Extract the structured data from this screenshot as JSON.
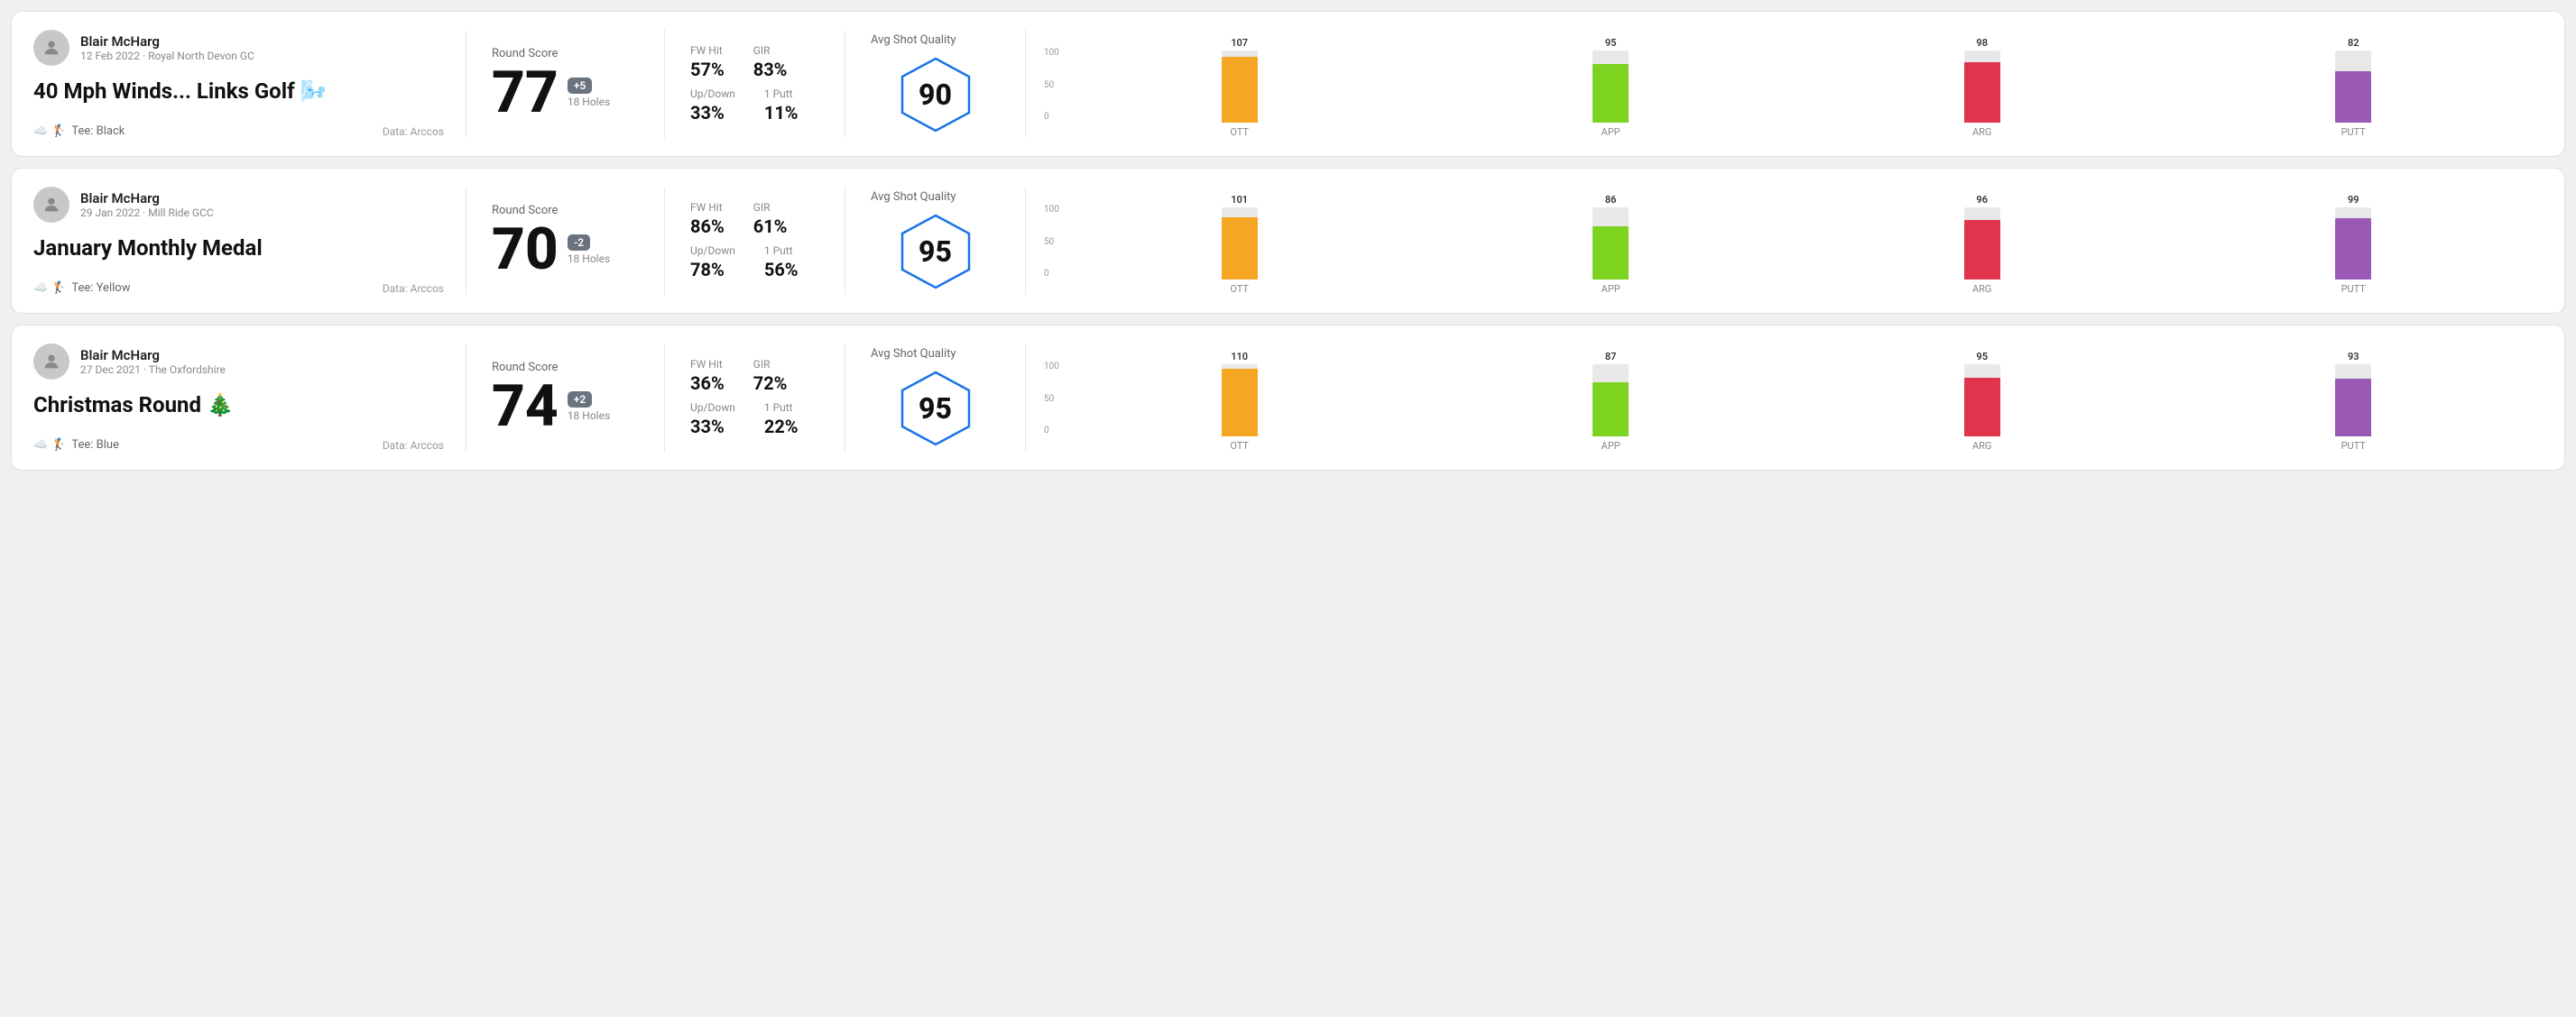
{
  "rounds": [
    {
      "id": "round1",
      "player_name": "Blair McHarg",
      "date": "12 Feb 2022 · Royal North Devon GC",
      "title": "40 Mph Winds... Links Golf 🌬️",
      "tee": "Tee: Black",
      "data_source": "Data: Arccos",
      "round_score_label": "Round Score",
      "score": "77",
      "badge": "+5",
      "badge_type": "pos",
      "holes": "18 Holes",
      "fw_hit_label": "FW Hit",
      "fw_hit": "57%",
      "gir_label": "GIR",
      "gir": "83%",
      "updown_label": "Up/Down",
      "updown": "33%",
      "putt1_label": "1 Putt",
      "putt1": "11%",
      "quality_label": "Avg Shot Quality",
      "quality_score": "90",
      "bars": [
        {
          "label": "OTT",
          "value": 107,
          "color_class": "ott-color",
          "max": 120
        },
        {
          "label": "APP",
          "value": 95,
          "color_class": "app-color",
          "max": 120
        },
        {
          "label": "ARG",
          "value": 98,
          "color_class": "arg-color",
          "max": 120
        },
        {
          "label": "PUTT",
          "value": 82,
          "color_class": "putt-color",
          "max": 120
        }
      ]
    },
    {
      "id": "round2",
      "player_name": "Blair McHarg",
      "date": "29 Jan 2022 · Mill Ride GCC",
      "title": "January Monthly Medal",
      "tee": "Tee: Yellow",
      "data_source": "Data: Arccos",
      "round_score_label": "Round Score",
      "score": "70",
      "badge": "-2",
      "badge_type": "neg",
      "holes": "18 Holes",
      "fw_hit_label": "FW Hit",
      "fw_hit": "86%",
      "gir_label": "GIR",
      "gir": "61%",
      "updown_label": "Up/Down",
      "updown": "78%",
      "putt1_label": "1 Putt",
      "putt1": "56%",
      "quality_label": "Avg Shot Quality",
      "quality_score": "95",
      "bars": [
        {
          "label": "OTT",
          "value": 101,
          "color_class": "ott-color",
          "max": 120
        },
        {
          "label": "APP",
          "value": 86,
          "color_class": "app-color",
          "max": 120
        },
        {
          "label": "ARG",
          "value": 96,
          "color_class": "arg-color",
          "max": 120
        },
        {
          "label": "PUTT",
          "value": 99,
          "color_class": "putt-color",
          "max": 120
        }
      ]
    },
    {
      "id": "round3",
      "player_name": "Blair McHarg",
      "date": "27 Dec 2021 · The Oxfordshire",
      "title": "Christmas Round 🎄",
      "tee": "Tee: Blue",
      "data_source": "Data: Arccos",
      "round_score_label": "Round Score",
      "score": "74",
      "badge": "+2",
      "badge_type": "pos",
      "holes": "18 Holes",
      "fw_hit_label": "FW Hit",
      "fw_hit": "36%",
      "gir_label": "GIR",
      "gir": "72%",
      "updown_label": "Up/Down",
      "updown": "33%",
      "putt1_label": "1 Putt",
      "putt1": "22%",
      "quality_label": "Avg Shot Quality",
      "quality_score": "95",
      "bars": [
        {
          "label": "OTT",
          "value": 110,
          "color_class": "ott-color",
          "max": 120
        },
        {
          "label": "APP",
          "value": 87,
          "color_class": "app-color",
          "max": 120
        },
        {
          "label": "ARG",
          "value": 95,
          "color_class": "arg-color",
          "max": 120
        },
        {
          "label": "PUTT",
          "value": 93,
          "color_class": "putt-color",
          "max": 120
        }
      ]
    }
  ],
  "y_axis_labels": [
    "100",
    "50",
    "0"
  ]
}
